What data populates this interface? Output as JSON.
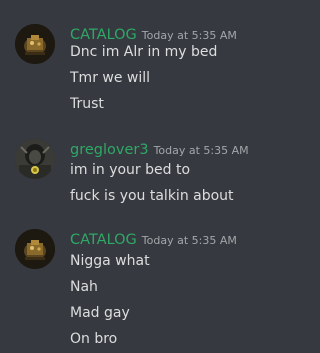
{
  "colors": {
    "background": "#36393f",
    "username": "#2fa866",
    "timestamp": "#a3a6aa",
    "message_text": "#dcddde"
  },
  "groups": [
    {
      "username": "CATALOG",
      "timestamp": "Today at 5:35 AM",
      "avatar": "catalog-avatar",
      "messages": [
        "Dnc im Alr in my bed",
        "Tmr we will",
        "Trust"
      ]
    },
    {
      "username": "greglover3",
      "timestamp": "Today at 5:35 AM",
      "avatar": "greglover3-avatar",
      "messages": [
        "im in your bed to",
        "fuck is you talkin about"
      ]
    },
    {
      "username": "CATALOG",
      "timestamp": "Today at 5:35 AM",
      "avatar": "catalog-avatar",
      "messages": [
        "Nigga what",
        "Nah",
        "Mad gay",
        "On bro"
      ]
    }
  ]
}
